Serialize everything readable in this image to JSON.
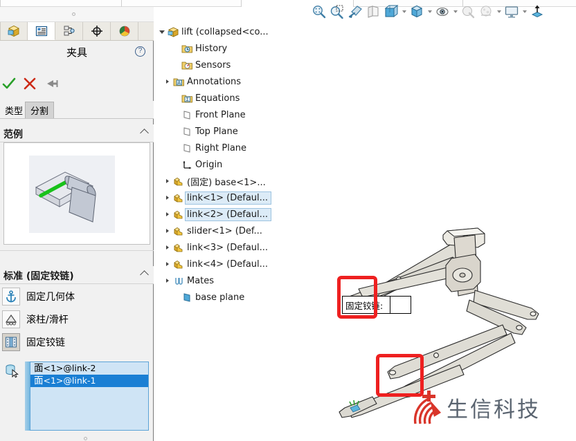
{
  "window": {
    "top_tabs_note": "partial document tab strip"
  },
  "property_manager": {
    "tabs": [
      {
        "name": "feature-manager-tab",
        "icon": "cube-icon",
        "active": false
      },
      {
        "name": "property-manager-tab",
        "icon": "list-properties-icon",
        "active": true
      },
      {
        "name": "configuration-manager-tab",
        "icon": "configuration-icon",
        "active": false
      },
      {
        "name": "simulation-study-tab",
        "icon": "crosshair-icon",
        "active": false
      },
      {
        "name": "display-manager-tab",
        "icon": "color-sphere-icon",
        "active": false
      }
    ],
    "title": "夹具",
    "help_glyph": "?",
    "actions": {
      "ok_label": "确定",
      "cancel_label": "取消",
      "pin_label": "固定"
    },
    "subtabs": [
      {
        "label": "类型",
        "selected": false
      },
      {
        "label": "分割",
        "selected": true
      }
    ],
    "example_section": {
      "title": "范例",
      "collapsed": false
    },
    "standard_section": {
      "title": "标准 (固定铰链)",
      "collapsed": false,
      "items": [
        {
          "label": "固定几何体",
          "icon": "anchor-icon",
          "selected": false
        },
        {
          "label": "滚柱/滑杆",
          "icon": "roller-slider-icon",
          "selected": false
        },
        {
          "label": "固定铰链",
          "icon": "fixed-hinge-icon",
          "selected": true
        }
      ]
    },
    "selection_box": {
      "icon": "face-select-cursor-icon",
      "entries": [
        {
          "prefix": "面",
          "suffix": "<1>@link-2",
          "selected": false
        },
        {
          "prefix": "面",
          "suffix": "<1>@link-1",
          "selected": true
        }
      ]
    }
  },
  "feature_tree": {
    "nodes": [
      {
        "label": "lift  (collapsed<co...",
        "icon": "assembly-icon",
        "arrow": "down",
        "indent": 0,
        "highlight": false
      },
      {
        "label": "History",
        "icon": "history-folder-icon",
        "arrow": "none",
        "indent": 1,
        "highlight": false
      },
      {
        "label": "Sensors",
        "icon": "sensors-folder-icon",
        "arrow": "none",
        "indent": 1,
        "highlight": false
      },
      {
        "label": "Annotations",
        "icon": "annotations-folder-icon",
        "arrow": "right",
        "indent": 1,
        "highlight": false
      },
      {
        "label": "Equations",
        "icon": "equations-folder-icon",
        "arrow": "none",
        "indent": 1,
        "highlight": false
      },
      {
        "label": "Front Plane",
        "icon": "plane-icon",
        "arrow": "none",
        "indent": 1,
        "highlight": false
      },
      {
        "label": "Top Plane",
        "icon": "plane-icon",
        "arrow": "none",
        "indent": 1,
        "highlight": false
      },
      {
        "label": "Right Plane",
        "icon": "plane-icon",
        "arrow": "none",
        "indent": 1,
        "highlight": false
      },
      {
        "label": "Origin",
        "icon": "origin-icon",
        "arrow": "none",
        "indent": 1,
        "highlight": false
      },
      {
        "label": "(固定) base<1>...",
        "icon": "part-icon",
        "arrow": "right",
        "indent": 1,
        "highlight": false
      },
      {
        "label": "link<1> (Defaul...",
        "icon": "part-icon",
        "arrow": "right",
        "indent": 1,
        "highlight": true
      },
      {
        "label": "link<2> (Defaul...",
        "icon": "part-icon",
        "arrow": "right",
        "indent": 1,
        "highlight": true
      },
      {
        "label": "slider<1> (Def...",
        "icon": "part-icon",
        "arrow": "right",
        "indent": 1,
        "highlight": false
      },
      {
        "label": "link<3> (Defaul...",
        "icon": "part-icon",
        "arrow": "right",
        "indent": 1,
        "highlight": false
      },
      {
        "label": "link<4> (Defaul...",
        "icon": "part-icon",
        "arrow": "right",
        "indent": 1,
        "highlight": false
      },
      {
        "label": "Mates",
        "icon": "mates-paperclip-icon",
        "arrow": "right",
        "indent": 1,
        "highlight": false
      },
      {
        "label": "base plane",
        "icon": "blue-plane-icon",
        "arrow": "none",
        "indent": 1,
        "highlight": false
      }
    ]
  },
  "toolbar": {
    "buttons": [
      {
        "name": "zoom-to-fit-icon",
        "caret": false
      },
      {
        "name": "zoom-to-area-icon",
        "caret": false
      },
      {
        "name": "rotate-view-icon",
        "caret": false
      },
      {
        "name": "section-view-icon",
        "caret": false
      },
      {
        "name": "view-orientation-icon",
        "caret": true
      },
      {
        "name": "display-style-icon",
        "caret": true
      },
      {
        "name": "hide-show-items-icon",
        "caret": true
      },
      {
        "name": "edit-appearance-icon",
        "caret": false
      },
      {
        "name": "apply-scene-icon",
        "caret": true
      },
      {
        "name": "view-settings-icon",
        "caret": true
      },
      {
        "name": "publish-3d-icon",
        "caret": false
      }
    ]
  },
  "viewport": {
    "callout": {
      "label": "固定铰链:",
      "value": ""
    },
    "highlight_boxes": [
      {
        "name": "fixture-callout-highlight",
        "color": "#ee2020"
      },
      {
        "name": "fixture-symbol-highlight",
        "color": "#ee2020"
      }
    ],
    "watermark": {
      "text": "生信科技",
      "logo_color": "#d9352a",
      "text_color": "#5a6470"
    }
  },
  "colors": {
    "panel_bg": "#f1f1f1",
    "selection_blue": "#1a7fd4",
    "selection_light": "#cfe4f5",
    "tree_highlight": "#dcebf7",
    "accent_red": "#ee2020",
    "ok_green": "#2aa02a",
    "cancel_red": "#cc2a16"
  }
}
